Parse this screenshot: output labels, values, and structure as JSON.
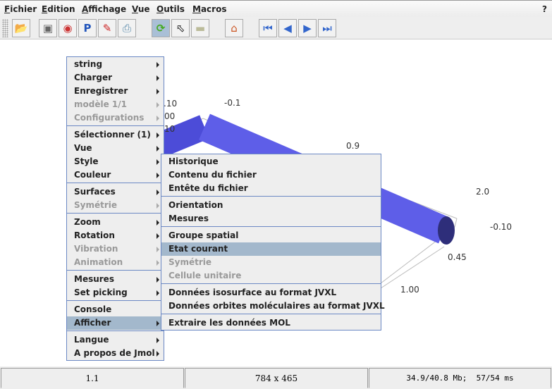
{
  "menubar": {
    "items": [
      {
        "first": "F",
        "rest": "ichier"
      },
      {
        "first": "E",
        "rest": "dition"
      },
      {
        "first": "A",
        "rest": "ffichage"
      },
      {
        "first": "V",
        "rest": "ue"
      },
      {
        "first": "O",
        "rest": "utils"
      },
      {
        "first": "M",
        "rest": "acros"
      }
    ],
    "help": "?"
  },
  "toolbar": {
    "buttons": [
      "open-icon",
      "camera-icon",
      "www-icon",
      "p-icon",
      "edit-icon",
      "print-icon",
      "rotate-icon",
      "select-icon",
      "ruler-icon",
      "home-icon",
      "first-icon",
      "prev-icon",
      "next-icon",
      "last-icon"
    ],
    "pressed": "rotate-icon"
  },
  "scene": {
    "labels": [
      ".10",
      "00",
      "10",
      "-0.1",
      "0.9",
      "2.0",
      "-0.10",
      "0.45",
      "1.00"
    ],
    "cylinder_color": "#5a5ae6"
  },
  "popup": {
    "items": [
      "string",
      "Charger",
      "Enregistrer",
      "modèle 1/1",
      "Configurations",
      "Sélectionner (1)",
      "Vue",
      "Style",
      "Couleur",
      "Surfaces",
      "Symétrie",
      "Zoom",
      "Rotation",
      "Vibration",
      "Animation",
      "Mesures",
      "Set picking",
      "Console",
      "Afficher",
      "Langue",
      "A propos de Jmol"
    ]
  },
  "submenu": {
    "items": [
      "Historique",
      "Contenu du fichier",
      "Entête du fichier",
      "Orientation",
      "Mesures",
      "Groupe spatial",
      "Etat courant",
      "Symétrie",
      "Cellule unitaire",
      "Données isosurface au format JVXL",
      "Données orbites moléculaires au format JVXL",
      "Extraire les données MOL"
    ]
  },
  "status": {
    "left": "1.1",
    "center": "784 x 465",
    "right": "34.9/40.8 Mb;  57/54 ms"
  },
  "colors": {
    "menu_border": "#6b88c4",
    "highlight": "#a3b8cc"
  }
}
